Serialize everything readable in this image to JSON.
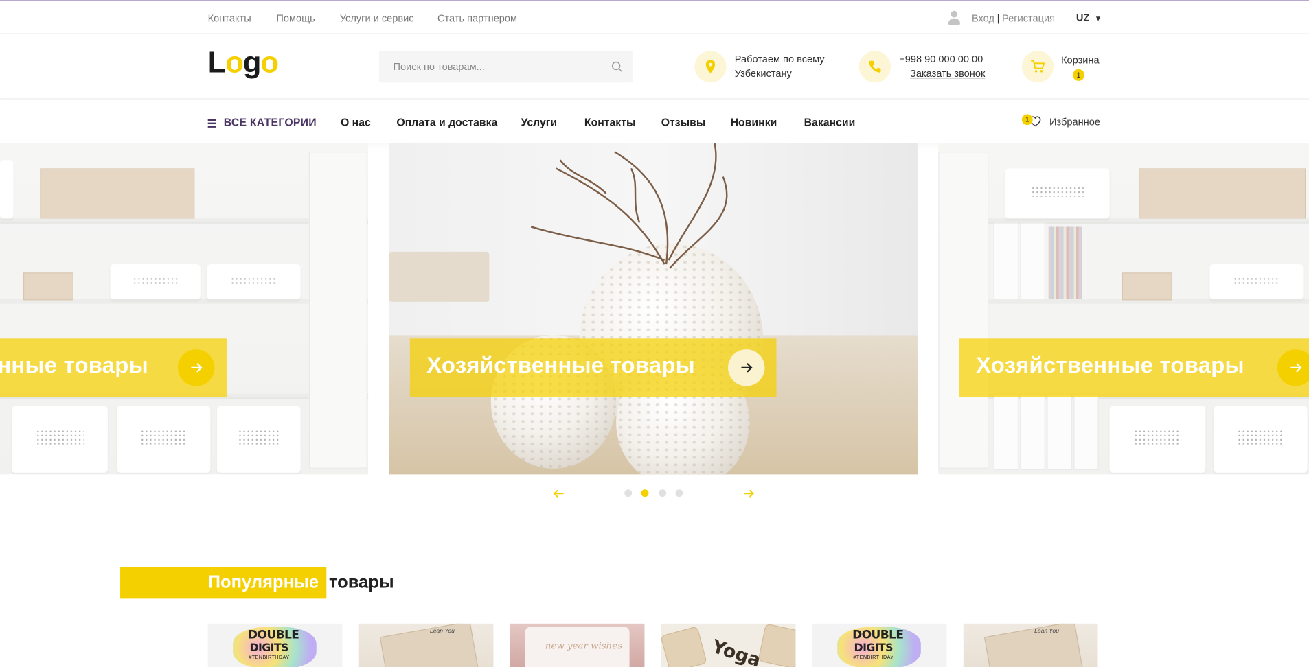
{
  "topbar": {
    "links": [
      "Контакты",
      "Помощь",
      "Услуги и сервис",
      "Стать партнером"
    ],
    "login": "Вход",
    "separator": "|",
    "register": "Регистация",
    "lang": "UZ"
  },
  "header": {
    "logo_part1": "L",
    "logo_part2": "o",
    "logo_part3": "g",
    "logo_part4": "o",
    "search_placeholder": "Поиск по товарам...",
    "location_line1": "Работаем по всему",
    "location_line2": "Узбекистану",
    "phone": "+998 90 000 00 00",
    "callback": "Заказать звонок",
    "cart_label": "Корзина",
    "cart_count": "1"
  },
  "nav": {
    "all_categories": "ВСЕ КАТЕГОРИИ",
    "items": [
      "О нас",
      "Оплата и доставка",
      "Услуги",
      "Контакты",
      "Отзывы",
      "Новинки",
      "Вакансии"
    ],
    "favorites_label": "Избранное",
    "favorites_count": "1"
  },
  "slider": {
    "slides": [
      {
        "title": "нные товары"
      },
      {
        "title": "Хозяйственные товары"
      },
      {
        "title": "Хозяйственные товары"
      }
    ],
    "active_dot": 2,
    "dots_total": 4
  },
  "popular": {
    "title_highlight": "Популярные",
    "title_rest": "товары",
    "products": [
      {
        "line1": "DOUBLE",
        "line2": "DIGITS",
        "line3": "#TENBIRTHDAY"
      },
      {
        "label": "Lean You"
      },
      {
        "script": "new year wishes"
      },
      {
        "word": "Yoga"
      },
      {
        "line1": "DOUBLE",
        "line2": "DIGITS",
        "line3": "#TENBIRTHDAY"
      },
      {
        "label": "Lean You"
      }
    ]
  },
  "colors": {
    "accent": "#f5d000",
    "nav_purple": "#4a3563"
  }
}
